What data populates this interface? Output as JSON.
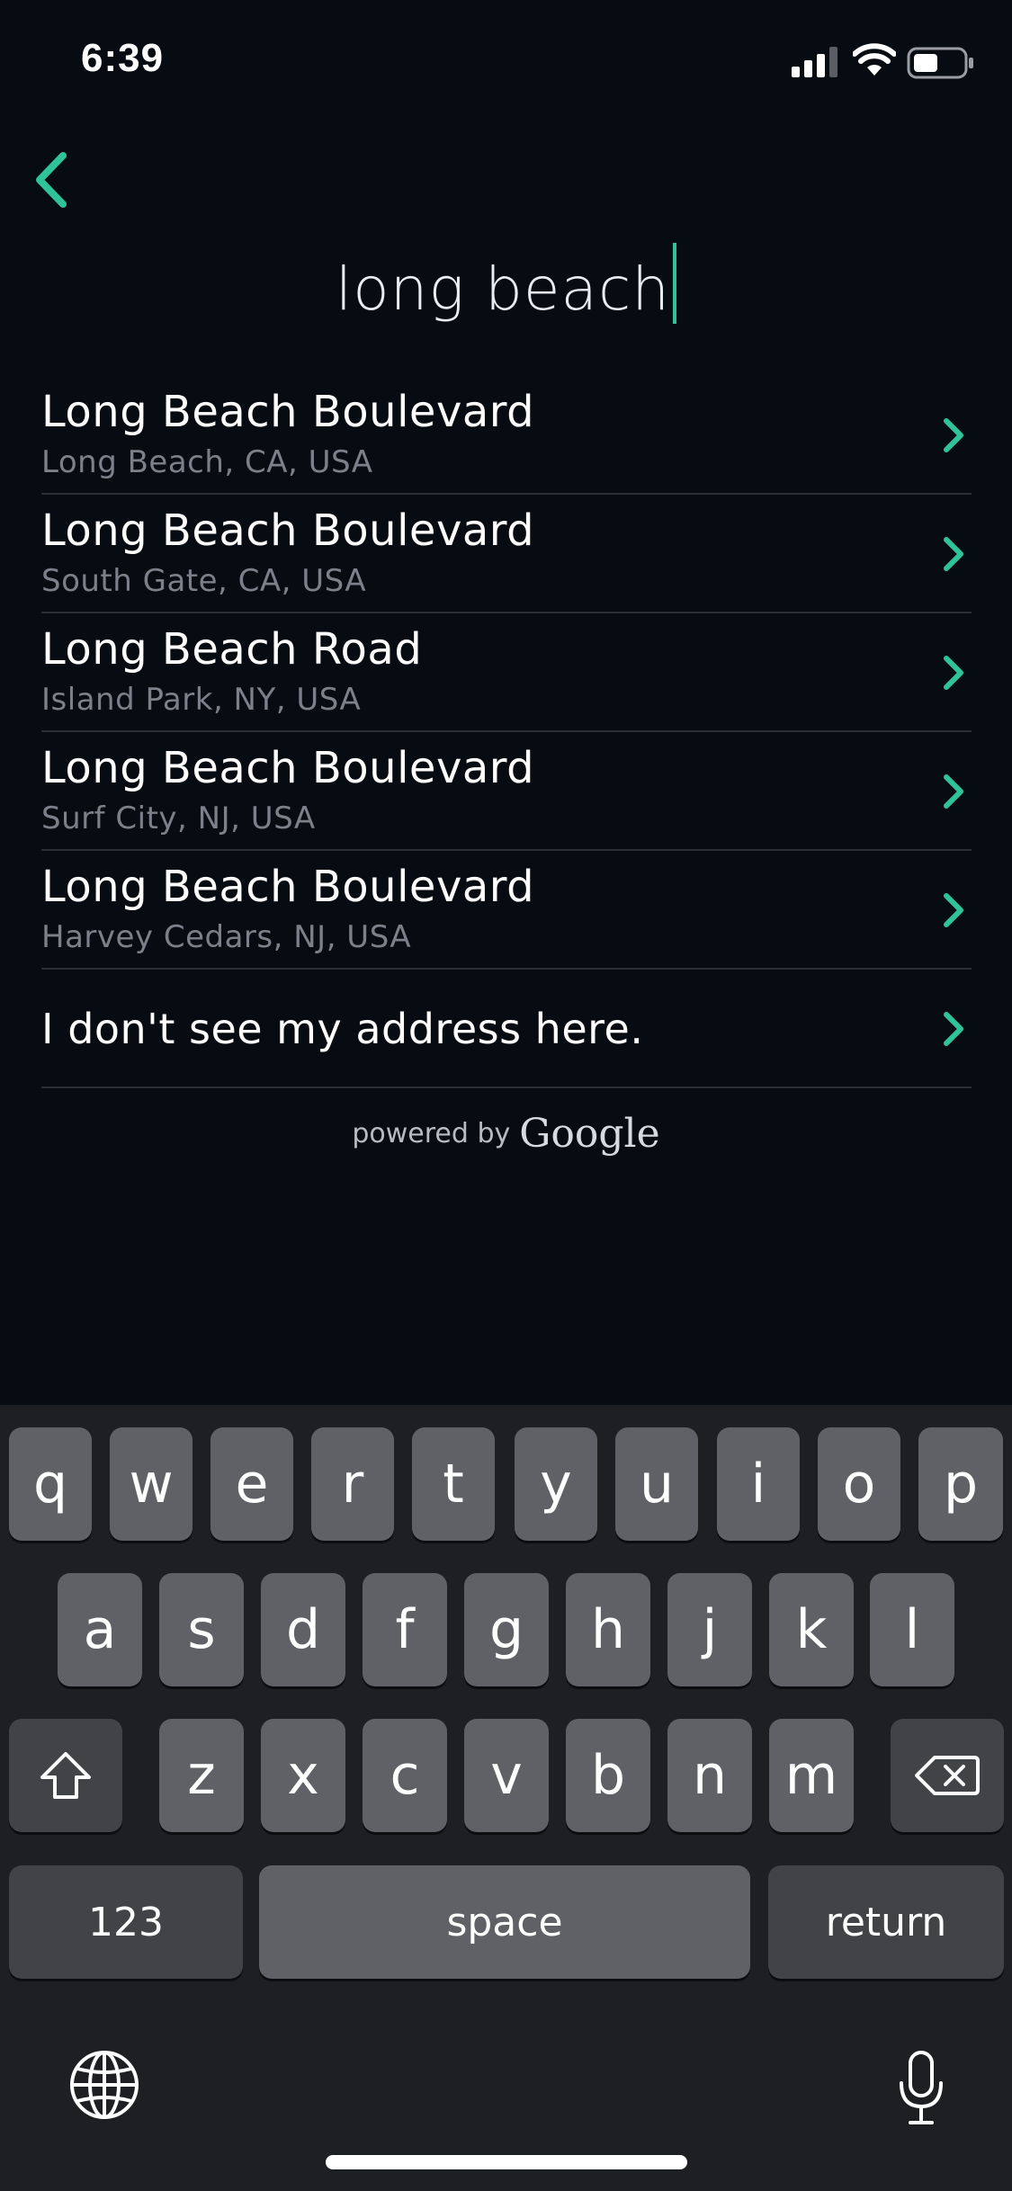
{
  "status_bar": {
    "time": "6:39",
    "icons": [
      "signal-icon",
      "wifi-icon",
      "battery-icon"
    ]
  },
  "header": {
    "back_icon": "chevron-left-icon",
    "search_query": "long beach"
  },
  "results": [
    {
      "title": "Long Beach Boulevard",
      "subtitle": "Long Beach, CA, USA"
    },
    {
      "title": "Long Beach Boulevard",
      "subtitle": "South Gate, CA, USA"
    },
    {
      "title": "Long Beach Road",
      "subtitle": "Island Park, NY, USA"
    },
    {
      "title": "Long Beach Boulevard",
      "subtitle": "Surf City, NJ, USA"
    },
    {
      "title": "Long Beach Boulevard",
      "subtitle": "Harvey Cedars, NJ, USA"
    }
  ],
  "no_address_label": "I don't see my address here.",
  "attribution": {
    "powered_by": "powered by",
    "brand": "Google"
  },
  "keyboard": {
    "row1": [
      "q",
      "w",
      "e",
      "r",
      "t",
      "y",
      "u",
      "i",
      "o",
      "p"
    ],
    "row2": [
      "a",
      "s",
      "d",
      "f",
      "g",
      "h",
      "j",
      "k",
      "l"
    ],
    "row3": [
      "z",
      "x",
      "c",
      "v",
      "b",
      "n",
      "m"
    ],
    "numbers_key": "123",
    "space_key": "space",
    "return_key": "return"
  },
  "colors": {
    "accent": "#2fc39a",
    "background": "#070b12",
    "divider": "#2a2f37",
    "subtitle": "#7b818b"
  }
}
